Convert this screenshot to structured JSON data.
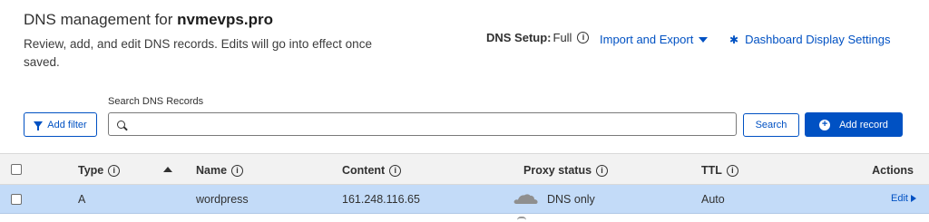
{
  "header": {
    "title_prefix": "DNS management for",
    "domain": "nvmevps.pro",
    "description": "Review, add, and edit DNS records. Edits will go into effect once saved."
  },
  "toolbar": {
    "dns_setup_label": "DNS Setup:",
    "dns_setup_value": "Full",
    "import_export_label": "Import and Export",
    "dashboard_settings_label": "Dashboard Display Settings"
  },
  "search": {
    "label": "Search DNS Records",
    "value": "",
    "placeholder": "",
    "add_filter_label": "Add filter",
    "search_button_label": "Search",
    "add_record_label": "Add record"
  },
  "table": {
    "columns": {
      "type": "Type",
      "name": "Name",
      "content": "Content",
      "proxy_status": "Proxy status",
      "ttl": "TTL",
      "actions": "Actions"
    },
    "rows": [
      {
        "type": "A",
        "name": "wordpress",
        "content": "161.248.116.65",
        "proxy_status": "DNS only",
        "ttl": "Auto",
        "action": "Edit"
      }
    ]
  },
  "colors": {
    "accent": "#0051c3",
    "selected_row": "#c3dbf8",
    "header_bg": "#f2f2f2"
  },
  "icons": {
    "info": "info-icon",
    "caret": "caret-down-icon",
    "gear": "gear-icon",
    "filter": "filter-icon",
    "search": "search-icon",
    "add": "plus-circle-icon",
    "sort": "sort-ascending-icon",
    "proxy": "cloud-icon",
    "edit": "chevron-right-icon"
  }
}
